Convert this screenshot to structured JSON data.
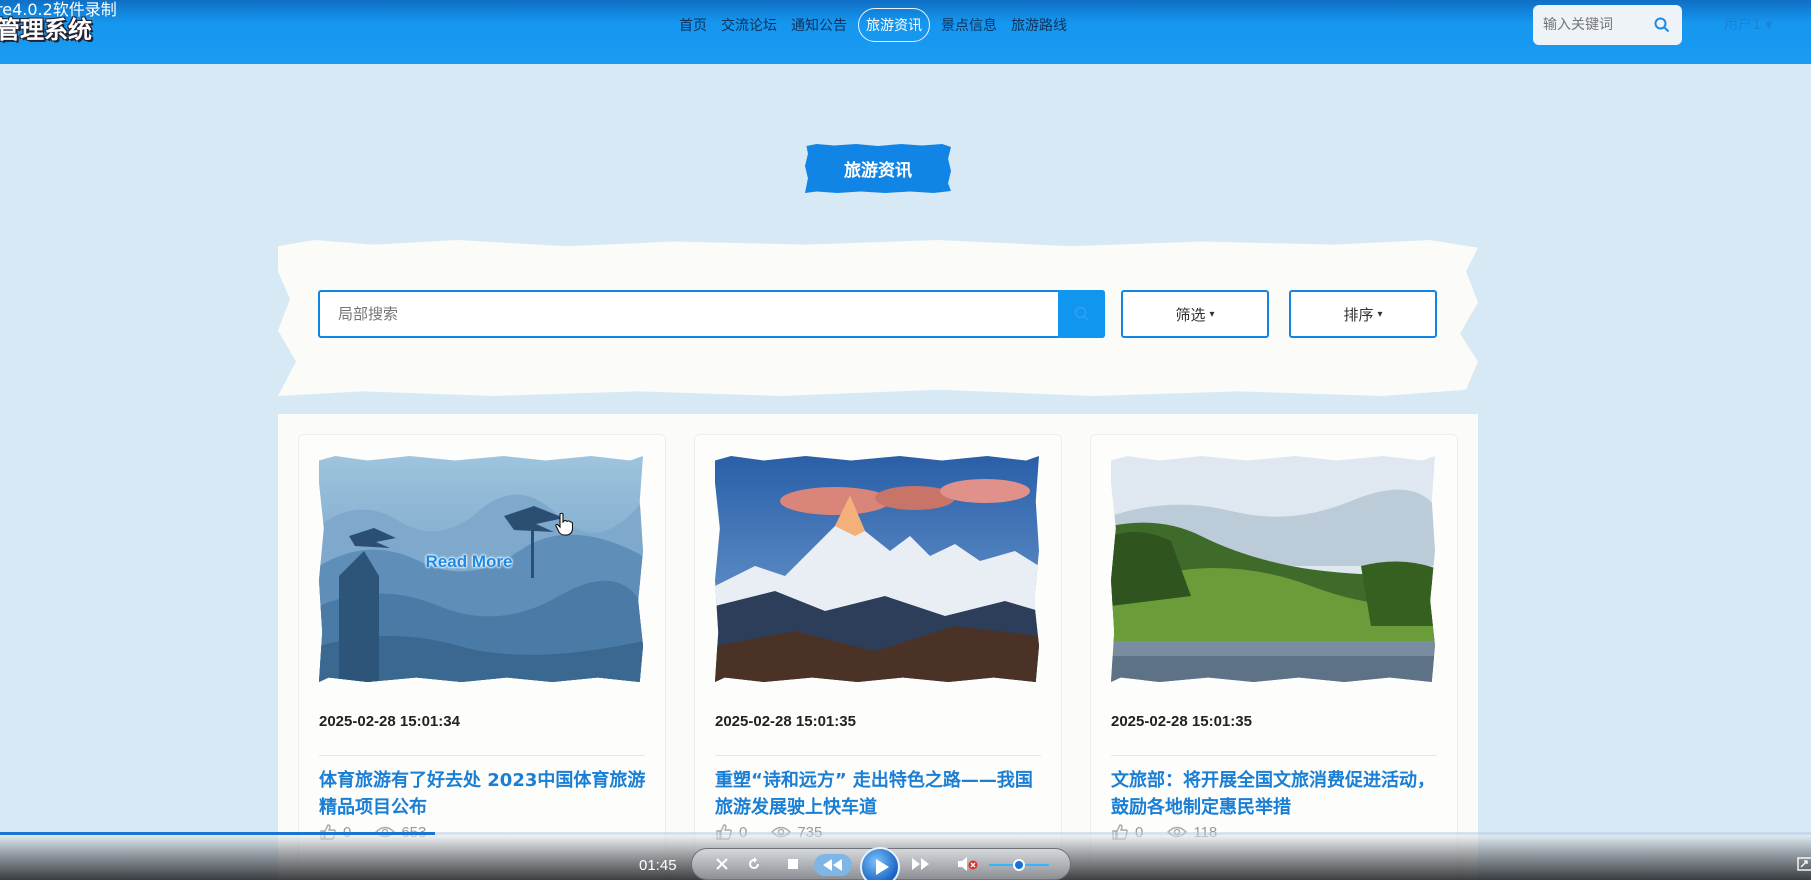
{
  "recorder": {
    "title": "re4.0.2软件录制",
    "time": "01:45",
    "progress_fraction": 0.24,
    "volume_fraction": 0.5
  },
  "header": {
    "brand": "管理系统",
    "nav": [
      {
        "label": "首页",
        "active": false
      },
      {
        "label": "交流论坛",
        "active": false
      },
      {
        "label": "通知公告",
        "active": false
      },
      {
        "label": "旅游资讯",
        "active": true
      },
      {
        "label": "景点信息",
        "active": false
      },
      {
        "label": "旅游路线",
        "active": false
      }
    ],
    "search_placeholder": "输入关键词",
    "user_label": "用户1",
    "user_caret": "▾"
  },
  "page": {
    "section_title": "旅游资讯",
    "local_search_placeholder": "局部搜索",
    "filter_label": "筛选",
    "sort_label": "排序",
    "caret": "▾"
  },
  "articles": [
    {
      "date": "2025-02-28 15:01:34",
      "title": "体育旅游有了好去处 2023中国体育旅游精品项目公布",
      "likes": "0",
      "views": "653",
      "hover_label": "Read More",
      "image": "misty-mountain-pines"
    },
    {
      "date": "2025-02-28 15:01:35",
      "title": "重塑“诗和远方” 走出特色之路——我国旅游发展驶上快车道",
      "likes": "0",
      "views": "735",
      "image": "snow-peaks-sunset"
    },
    {
      "date": "2025-02-28 15:01:35",
      "title": "文旅部：将开展全国文旅消费促进活动，鼓励各地制定惠民举措",
      "likes": "0",
      "views": "118",
      "image": "green-hills-lake"
    }
  ],
  "icons": {
    "search": "search-icon",
    "like": "thumbs-up-icon",
    "view": "eye-icon"
  },
  "colors": {
    "primary": "#1185e5",
    "nav_bar": "#1596ef",
    "page_bg": "#d8e9f6",
    "title": "#1a7fd4"
  }
}
